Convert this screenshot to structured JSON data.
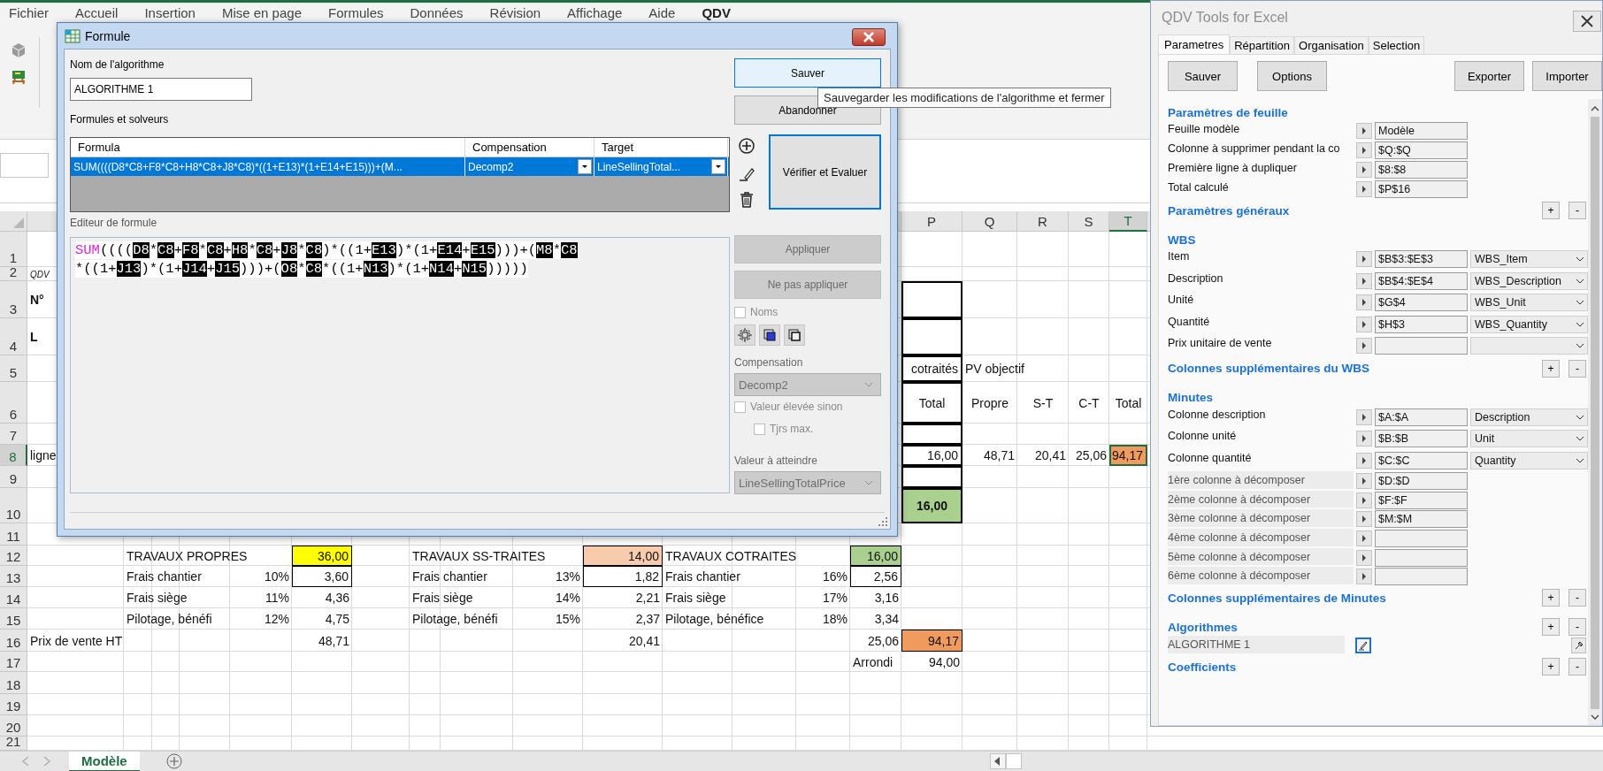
{
  "ribbon": {
    "tabs": [
      {
        "label": "Fichier",
        "selected": false
      },
      {
        "label": "Accueil",
        "selected": false
      },
      {
        "label": "Insertion",
        "selected": false
      },
      {
        "label": "Mise en page",
        "selected": false
      },
      {
        "label": "Formules",
        "selected": false
      },
      {
        "label": "Données",
        "selected": false
      },
      {
        "label": "Révision",
        "selected": false
      },
      {
        "label": "Affichage",
        "selected": false
      },
      {
        "label": "Aide",
        "selected": false
      },
      {
        "label": "QDV",
        "selected": true
      }
    ]
  },
  "sheet": {
    "columns": [
      {
        "label": "P",
        "selected": false
      },
      {
        "label": "Q",
        "selected": false
      },
      {
        "label": "R",
        "selected": false
      },
      {
        "label": "S",
        "selected": false
      },
      {
        "label": "T",
        "selected": true
      }
    ],
    "rows": [
      {
        "number": "1",
        "selected": false
      },
      {
        "number": "2",
        "selected": false,
        "cells": [
          {
            "text": "QDV",
            "kind": "text",
            "italic": true,
            "selected": false
          }
        ]
      },
      {
        "number": "3",
        "selected": false,
        "cells": [
          {
            "text": "N°",
            "kind": "text",
            "bold": true,
            "selected": false
          },
          null,
          null,
          null,
          null,
          null,
          null,
          null,
          null,
          null,
          null,
          null,
          null,
          null,
          null,
          {
            "thick": true,
            "selected": false
          }
        ]
      },
      {
        "number": "4",
        "selected": false,
        "cells": [
          {
            "text": "L",
            "kind": "text",
            "bold": true,
            "selected": false
          },
          null,
          null,
          null,
          null,
          null,
          null,
          null,
          null,
          null,
          null,
          null,
          null,
          null,
          null,
          {
            "thick": true,
            "selected": false
          }
        ]
      },
      {
        "number": "5",
        "selected": false,
        "cells": [
          null,
          null,
          null,
          null,
          null,
          null,
          null,
          null,
          null,
          null,
          null,
          null,
          null,
          null,
          null,
          {
            "text": "cotraités",
            "kind": "overflow",
            "thick": true,
            "selected": false
          },
          {
            "text": "PV objectif",
            "kind": "text",
            "selected": false
          }
        ]
      },
      {
        "number": "6",
        "selected": false,
        "cells": [
          null,
          null,
          null,
          null,
          null,
          null,
          null,
          null,
          null,
          null,
          null,
          null,
          null,
          null,
          null,
          {
            "text": "Total",
            "kind": "heading",
            "thick": true,
            "selected": false
          },
          {
            "text": "Propre",
            "kind": "heading",
            "selected": false
          },
          {
            "text": "S-T",
            "kind": "heading",
            "selected": false
          },
          {
            "text": "C-T",
            "kind": "heading",
            "selected": false
          },
          {
            "text": "Total",
            "kind": "heading",
            "selected": false
          }
        ]
      },
      {
        "number": "7",
        "selected": false,
        "cells": [
          null,
          null,
          null,
          null,
          null,
          null,
          null,
          null,
          null,
          null,
          null,
          null,
          null,
          null,
          null,
          {
            "thick": true,
            "selected": false
          }
        ]
      },
      {
        "number": "8",
        "selected": true,
        "cells": [
          {
            "text": "ligne",
            "kind": "text",
            "selected": false
          },
          null,
          null,
          null,
          null,
          null,
          null,
          null,
          null,
          null,
          null,
          null,
          null,
          null,
          null,
          {
            "text": "16,00",
            "kind": "number",
            "thick": true,
            "selected": false
          },
          {
            "text": "48,71",
            "kind": "number",
            "selected": false
          },
          {
            "text": "20,41",
            "kind": "number",
            "selected": false
          },
          {
            "text": "25,06",
            "kind": "number",
            "selected": false
          },
          {
            "text": "94,17",
            "kind": "number",
            "color": "#f19a5e",
            "selected": true
          }
        ]
      },
      {
        "number": "9",
        "selected": false,
        "cells": [
          null,
          null,
          null,
          null,
          null,
          null,
          null,
          null,
          null,
          null,
          null,
          null,
          null,
          null,
          null,
          {
            "thick": true,
            "selected": false
          }
        ]
      },
      {
        "number": "10",
        "selected": false,
        "cells": [
          null,
          null,
          null,
          null,
          null,
          null,
          null,
          null,
          null,
          null,
          null,
          null,
          null,
          null,
          null,
          {
            "text": "16,00",
            "kind": "heading",
            "bold": true,
            "color": "#a9d08e",
            "thick": true,
            "selected": false
          }
        ]
      },
      {
        "number": "11",
        "selected": false
      },
      {
        "number": "12",
        "selected": false,
        "cells": [
          null,
          {
            "text": "TRAVAUX PROPRES",
            "kind": "text",
            "selected": false
          },
          null,
          null,
          null,
          {
            "text": "36,00",
            "kind": "number",
            "color": "#ffff00",
            "outlined": true,
            "selected": false
          },
          null,
          {
            "text": "TRAVAUX SS-TRAITES",
            "kind": "text",
            "selected": false
          },
          null,
          null,
          {
            "text": "14,00",
            "kind": "number",
            "color": "#f8cbad",
            "outlined": true,
            "selected": false
          },
          {
            "text": "TRAVAUX COTRAITES",
            "kind": "text",
            "selected": false
          },
          null,
          null,
          {
            "text": "16,00",
            "kind": "number",
            "color": "#a9d08e",
            "outlined": true,
            "selected": false
          }
        ]
      },
      {
        "number": "13",
        "selected": false,
        "cells": [
          null,
          {
            "text": "Frais chantier",
            "kind": "text",
            "selected": false
          },
          null,
          null,
          {
            "text": "10%",
            "kind": "number",
            "selected": false
          },
          {
            "text": "3,60",
            "kind": "number",
            "outlined": true,
            "selected": false
          },
          null,
          {
            "text": "Frais chantier",
            "kind": "text",
            "selected": false
          },
          null,
          {
            "text": "13%",
            "kind": "number",
            "selected": false
          },
          {
            "text": "1,82",
            "kind": "number",
            "outlined": true,
            "selected": false
          },
          {
            "text": "Frais chantier",
            "kind": "text",
            "selected": false
          },
          null,
          {
            "text": "16%",
            "kind": "number",
            "selected": false
          },
          {
            "text": "2,56",
            "kind": "number",
            "outlined": true,
            "selected": false
          }
        ]
      },
      {
        "number": "14",
        "selected": false,
        "cells": [
          null,
          {
            "text": "Frais siège",
            "kind": "text",
            "selected": false
          },
          null,
          null,
          {
            "text": "11%",
            "kind": "number",
            "selected": false
          },
          {
            "text": "4,36",
            "kind": "number",
            "selected": false
          },
          null,
          {
            "text": "Frais siège",
            "kind": "text",
            "selected": false
          },
          null,
          {
            "text": "14%",
            "kind": "number",
            "selected": false
          },
          {
            "text": "2,21",
            "kind": "number",
            "selected": false
          },
          {
            "text": "Frais siège",
            "kind": "text",
            "selected": false
          },
          null,
          {
            "text": "17%",
            "kind": "number",
            "selected": false
          },
          {
            "text": "3,16",
            "kind": "number",
            "selected": false
          }
        ]
      },
      {
        "number": "15",
        "selected": false,
        "cells": [
          null,
          {
            "text": "Pilotage, bénéfi",
            "kind": "text",
            "selected": false
          },
          null,
          null,
          {
            "text": "12%",
            "kind": "number",
            "selected": false
          },
          {
            "text": "4,75",
            "kind": "number",
            "selected": false
          },
          null,
          {
            "text": "Pilotage, bénéfi",
            "kind": "text",
            "selected": false
          },
          null,
          {
            "text": "15%",
            "kind": "number",
            "selected": false
          },
          {
            "text": "2,37",
            "kind": "number",
            "selected": false
          },
          {
            "text": "Pilotage, bénéfice",
            "kind": "text",
            "selected": false
          },
          null,
          {
            "text": "18%",
            "kind": "number",
            "selected": false
          },
          {
            "text": "3,34",
            "kind": "number",
            "selected": false
          }
        ]
      },
      {
        "number": "16",
        "selected": false,
        "cells": [
          {
            "text": "Prix de vente HT",
            "kind": "text",
            "selected": false
          },
          null,
          null,
          null,
          null,
          {
            "text": "48,71",
            "kind": "number",
            "selected": false
          },
          null,
          null,
          null,
          null,
          {
            "text": "20,41",
            "kind": "number",
            "selected": false
          },
          null,
          null,
          null,
          {
            "text": "25,06",
            "kind": "number",
            "selected": false
          },
          {
            "text": "94,17",
            "kind": "number",
            "color": "#f19a5e",
            "outlined": true,
            "selected": false
          }
        ]
      },
      {
        "number": "17",
        "selected": false,
        "cells": [
          null,
          null,
          null,
          null,
          null,
          null,
          null,
          null,
          null,
          null,
          null,
          null,
          null,
          null,
          {
            "text": "Arrondi",
            "kind": "text",
            "selected": false
          },
          {
            "text": "94,00",
            "kind": "number",
            "selected": false
          }
        ]
      },
      {
        "number": "18",
        "selected": false
      },
      {
        "number": "19",
        "selected": false
      },
      {
        "number": "20",
        "selected": false
      },
      {
        "number": "21",
        "selected": false
      }
    ]
  },
  "sheet_tabs": [
    {
      "label": "Modèle",
      "selected": true
    }
  ],
  "dialog": {
    "title": "Formule",
    "name_label": "Nom de l'algorithme",
    "name_value": "ALGORITHME 1",
    "formulas_label": "Formules et solveurs",
    "table": {
      "columns": [
        "Formula",
        "Compensation",
        "Target"
      ],
      "rows": [
        {
          "selected": true,
          "formula": "SUM((((D8*C8+F8*C8+H8*C8+J8*C8)*((1+E13)*(1+E14+E15)))+(M...",
          "compensation": "Decomp2",
          "target": "LineSellingTotal..."
        }
      ]
    },
    "editor_label": "Editeur de formule",
    "editor_lines": [
      [
        {
          "kind": "function",
          "text": "SUM"
        },
        {
          "kind": "op",
          "text": "(((("
        },
        {
          "kind": "ref",
          "text": "D8"
        },
        {
          "kind": "op",
          "text": "*"
        },
        {
          "kind": "ref",
          "text": "C8"
        },
        {
          "kind": "op",
          "text": "+"
        },
        {
          "kind": "ref",
          "text": "F8"
        },
        {
          "kind": "op",
          "text": "*"
        },
        {
          "kind": "ref",
          "text": "C8"
        },
        {
          "kind": "op",
          "text": "+"
        },
        {
          "kind": "ref",
          "text": "H8"
        },
        {
          "kind": "op",
          "text": "*"
        },
        {
          "kind": "ref",
          "text": "C8"
        },
        {
          "kind": "op",
          "text": "+"
        },
        {
          "kind": "ref",
          "text": "J8"
        },
        {
          "kind": "op",
          "text": "*"
        },
        {
          "kind": "ref",
          "text": "C8"
        },
        {
          "kind": "op",
          "text": ")*((1+"
        },
        {
          "kind": "ref",
          "text": "E13"
        },
        {
          "kind": "op",
          "text": ")*(1+"
        },
        {
          "kind": "ref",
          "text": "E14"
        },
        {
          "kind": "op",
          "text": "+"
        },
        {
          "kind": "ref",
          "text": "E15"
        },
        {
          "kind": "op",
          "text": ")))+("
        },
        {
          "kind": "ref",
          "text": "M8"
        },
        {
          "kind": "op",
          "text": "*"
        },
        {
          "kind": "ref",
          "text": "C8"
        }
      ],
      [
        {
          "kind": "op",
          "text": "*((1+"
        },
        {
          "kind": "ref",
          "text": "J13"
        },
        {
          "kind": "op",
          "text": ")*(1+"
        },
        {
          "kind": "ref",
          "text": "J14"
        },
        {
          "kind": "op",
          "text": "+"
        },
        {
          "kind": "ref",
          "text": "J15"
        },
        {
          "kind": "op",
          "text": ")))+("
        },
        {
          "kind": "ref",
          "text": "O8"
        },
        {
          "kind": "op",
          "text": "*"
        },
        {
          "kind": "ref",
          "text": "C8"
        },
        {
          "kind": "op",
          "text": "*((1+"
        },
        {
          "kind": "ref",
          "text": "N13"
        },
        {
          "kind": "op",
          "text": ")*(1+"
        },
        {
          "kind": "ref",
          "text": "N14"
        },
        {
          "kind": "op",
          "text": "+"
        },
        {
          "kind": "ref",
          "text": "N15"
        },
        {
          "kind": "op",
          "text": ")))))"
        }
      ]
    ],
    "buttons": [
      {
        "label": "Sauver",
        "hover": true
      },
      {
        "label": "Abandonner",
        "hover": false
      }
    ],
    "evaluate_button": {
      "label": "Vérifier et Evaluer",
      "default": true
    },
    "apply_buttons": [
      {
        "label": "Appliquer",
        "disabled": true
      },
      {
        "label": "Ne pas appliquer",
        "disabled": true
      }
    ],
    "names_checkbox": {
      "label": "Noms",
      "checked": false,
      "disabled": true
    },
    "compensation": {
      "label": "Compensation",
      "value": "Decomp2",
      "disabled": true
    },
    "options": [
      {
        "label": "Valeur élevée sinon",
        "checked": false,
        "disabled": true,
        "children": [
          {
            "label": "Tjrs max.",
            "checked": false,
            "disabled": true
          }
        ]
      }
    ],
    "target": {
      "label": "Valeur à atteindre",
      "value": "LineSellingTotalPrice",
      "disabled": true
    }
  },
  "tooltip": "Sauvegarder les modifications de l'algorithme et fermer",
  "panel": {
    "title": "QDV Tools for Excel",
    "tabs": [
      {
        "label": "Parametres",
        "selected": true
      },
      {
        "label": "Répartition",
        "selected": false
      },
      {
        "label": "Organisation",
        "selected": false
      },
      {
        "label": "Selection",
        "selected": false
      }
    ],
    "left_buttons": [
      "Sauver",
      "Options"
    ],
    "right_buttons": [
      "Exporter",
      "Importer"
    ],
    "sections": [
      {
        "title": "Paramètres de feuille",
        "rows": [
          {
            "kind": "field",
            "label": "Feuille modèle",
            "value": "Modèle"
          },
          {
            "kind": "field",
            "label": "Colonne à supprimer pendant la co",
            "value": "$Q:$Q"
          },
          {
            "kind": "field",
            "label": "Première ligne à dupliquer",
            "value": "$8:$8"
          },
          {
            "kind": "field",
            "label": "Total calculé",
            "value": "$P$16"
          }
        ]
      },
      {
        "title": "Paramètres généraux",
        "buttons": [
          "+",
          "-"
        ]
      },
      {
        "title": "WBS",
        "rows": [
          {
            "kind": "mapped",
            "label": "Item",
            "value": "$B$3:$E$3",
            "option": "WBS_Item"
          },
          {
            "kind": "mapped",
            "label": "Description",
            "value": "$B$4:$E$4",
            "option": "WBS_Description"
          },
          {
            "kind": "mapped",
            "label": "Unité",
            "value": "$G$4",
            "option": "WBS_Unit"
          },
          {
            "kind": "mapped",
            "label": "Quantité",
            "value": "$H$3",
            "option": "WBS_Quantity"
          },
          {
            "kind": "mapped",
            "label": "Prix unitaire de vente"
          }
        ]
      },
      {
        "title": "Colonnes supplémentaires du WBS",
        "buttons": [
          "+",
          "-"
        ]
      },
      {
        "title": "Minutes",
        "rows": [
          {
            "kind": "mapped",
            "label": "Colonne description",
            "value": "$A:$A",
            "option": "Description"
          },
          {
            "kind": "mapped",
            "label": "Colonne unité",
            "value": "$B:$B",
            "option": "Unit"
          },
          {
            "kind": "mapped",
            "label": "Colonne quantité",
            "value": "$C:$C",
            "option": "Quantity"
          },
          {
            "kind": "decompose",
            "label": "1ère colonne à décomposer",
            "value": "$D:$D"
          },
          {
            "kind": "decompose",
            "label": "2ème colonne à décomposer",
            "value": "$F:$F"
          },
          {
            "kind": "decompose",
            "label": "3ème colonne à décomposer",
            "value": "$M:$M"
          },
          {
            "kind": "decompose",
            "label": "4ème colonne à décomposer"
          },
          {
            "kind": "decompose",
            "label": "5ème colonne à décomposer"
          },
          {
            "kind": "decompose",
            "label": "6ème colonne à décomposer"
          }
        ]
      },
      {
        "title": "Colonnes supplémentaires de Minutes",
        "buttons": [
          "+",
          "-"
        ]
      },
      {
        "title": "Algorithmes",
        "buttons": [
          "+",
          "-"
        ],
        "rows": [
          {
            "kind": "algorithm",
            "label": "ALGORITHME 1"
          }
        ]
      },
      {
        "title": "Coefficients",
        "buttons": [
          "+",
          "-"
        ]
      }
    ]
  }
}
